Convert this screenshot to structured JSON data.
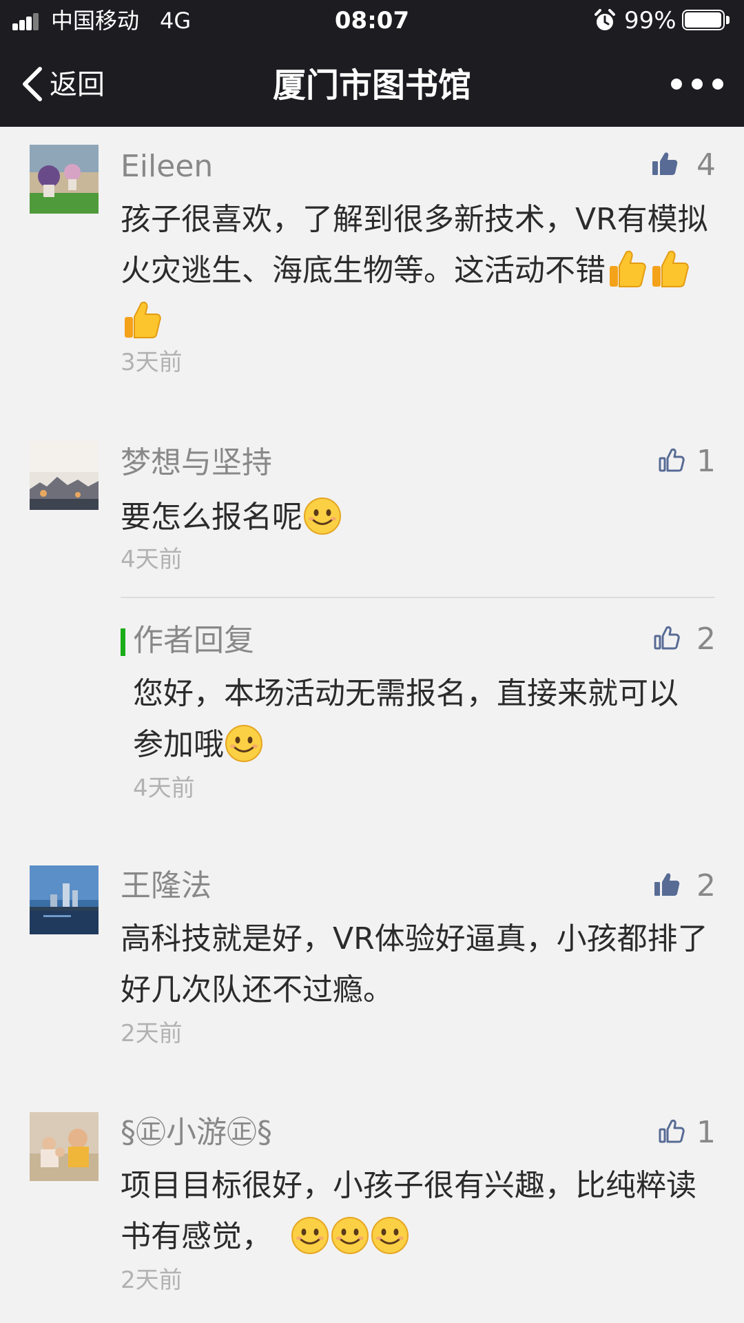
{
  "status": {
    "carrier": "中国移动",
    "network": "4G",
    "time": "08:07",
    "battery": "99%",
    "battery_level": 0.99
  },
  "nav": {
    "back_label": "返回",
    "title": "厦门市图书馆",
    "more_icon": "more-dots-icon"
  },
  "colors": {
    "bar_background": "#1c1c21",
    "page_background": "#f2f2f2",
    "like_active": "#576b95",
    "reply_accent": "#1aad19"
  },
  "comments": [
    {
      "author": "Eileen",
      "likes": "4",
      "liked": true,
      "text": "孩子很喜欢，了解到很多新技术，VR有模拟火灾逃生、海底生物等。这活动不错",
      "emoji": [
        "thumbs-up-emoji",
        "thumbs-up-emoji",
        "thumbs-up-emoji"
      ],
      "time": "3天前"
    },
    {
      "author": "梦想与坚持",
      "likes": "1",
      "liked": false,
      "text": "要怎么报名呢",
      "emoji": [
        "smile-emoji"
      ],
      "time": "4天前",
      "reply": {
        "label": "作者回复",
        "likes": "2",
        "liked": false,
        "text": "您好，本场活动无需报名，直接来就可以参加哦",
        "emoji": [
          "smile-emoji"
        ],
        "time": "4天前"
      }
    },
    {
      "author": "王隆法",
      "likes": "2",
      "liked": true,
      "text": "高科技就是好，VR体验好逼真，小孩都排了好几次队还不过瘾。",
      "time": "2天前"
    },
    {
      "author": "§㊣小游㊣§",
      "likes": "1",
      "liked": false,
      "text": "项目目标很好，小孩子很有兴趣，比纯粹读书有感觉，",
      "emoji": [
        "smile-emoji",
        "smile-emoji",
        "smile-emoji"
      ],
      "time": "2天前"
    }
  ]
}
